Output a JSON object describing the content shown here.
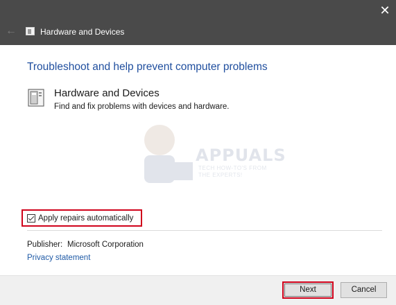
{
  "window": {
    "close_glyph": "✕",
    "back_glyph": "←",
    "title": "Hardware and Devices",
    "app_icon": "hardware-devices-icon"
  },
  "main": {
    "heading": "Troubleshoot and help prevent computer problems",
    "item": {
      "icon": "hardware-devices-icon",
      "title": "Hardware and Devices",
      "description": "Find and fix problems with devices and hardware."
    },
    "watermark": {
      "text": "APPUALS",
      "subtitle_line1": "TECH HOW-TO'S FROM",
      "subtitle_line2": "THE EXPERTS!"
    },
    "apply_repairs": {
      "label": "Apply repairs automatically",
      "checked": true
    },
    "publisher": {
      "label": "Publisher:",
      "value": "Microsoft Corporation"
    },
    "privacy_link": "Privacy statement"
  },
  "footer": {
    "next_label": "Next",
    "cancel_label": "Cancel"
  },
  "colors": {
    "titlebar": "#4a4a4a",
    "heading": "#1f4e9e",
    "link": "#1f5aa6",
    "highlight": "#d0021b"
  }
}
